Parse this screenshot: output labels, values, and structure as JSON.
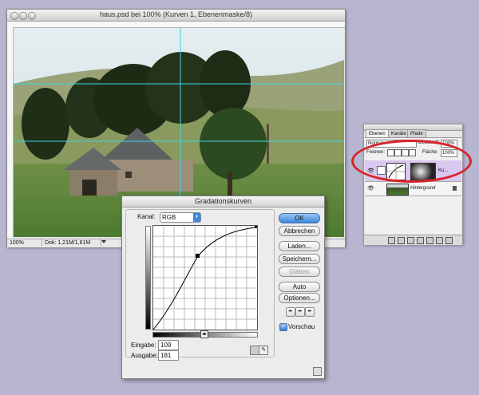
{
  "document": {
    "title": "haus.psd bei 100% (Kurven 1, Ebenenmaske/8)",
    "zoom": "100%",
    "doc_info": "Dok: 1,21M/1,61M"
  },
  "layers_panel": {
    "tabs": [
      {
        "label": "Ebenen"
      },
      {
        "label": "Kanäle"
      },
      {
        "label": "Pfade"
      }
    ],
    "blend_mode": "Normal",
    "opacity_label": "Deckkraft:",
    "opacity_value": "100%",
    "lock_label": "Fixieren:",
    "fill_label": "Fläche:",
    "fill_value": "100%",
    "layers": [
      {
        "name": "Ku...",
        "selected": true
      },
      {
        "name": "Hintergrund",
        "selected": false
      }
    ]
  },
  "curves": {
    "title": "Gradationskurven",
    "channel_label": "Kanal:",
    "channel_value": "RGB",
    "input_label": "Eingabe:",
    "input_value": "109",
    "output_label": "Ausgabe:",
    "output_value": "181",
    "buttons": {
      "ok": "OK",
      "cancel": "Abbrechen",
      "load": "Laden...",
      "save": "Speichern...",
      "smooth": "Glätten",
      "auto": "Auto",
      "options": "Optionen..."
    },
    "preview_label": "Vorschau",
    "preview_checked": true
  },
  "colors": {
    "accent": "#3d87e0",
    "highlight_oval": "#d8232a",
    "layer_selected": "#d9c7ef"
  }
}
